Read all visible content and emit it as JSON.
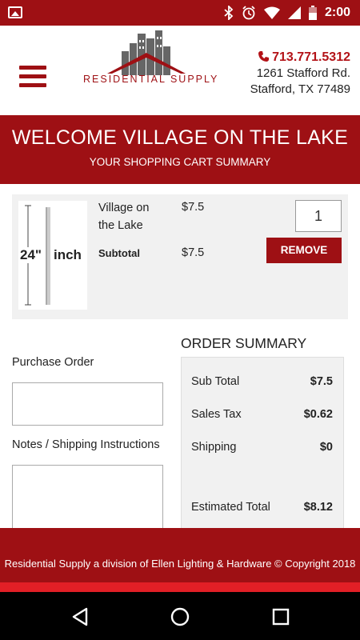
{
  "status_bar": {
    "time": "2:00"
  },
  "header": {
    "logo_text": "RESIDENTIAL SUPPLY",
    "phone": "713.771.5312",
    "address_line1": "1261 Stafford Rd.",
    "address_line2": "Stafford, TX 77489"
  },
  "banner": {
    "title": "WELCOME VILLAGE ON THE LAKE",
    "subtitle": "YOUR SHOPPING CART SUMMARY"
  },
  "cart_item": {
    "image_text_size": "24\"",
    "image_text_unit": "inch",
    "name": "Village on the Lake",
    "price": "$7.5",
    "subtotal_label": "Subtotal",
    "subtotal": "$7.5",
    "quantity": "1",
    "remove_label": "REMOVE"
  },
  "form": {
    "purchase_order_label": "Purchase Order",
    "notes_label": "Notes / Shipping Instructions"
  },
  "order_summary": {
    "title": "ORDER SUMMARY",
    "rows": [
      {
        "label": "Sub Total",
        "value": "$7.5"
      },
      {
        "label": "Sales Tax",
        "value": "$0.62"
      },
      {
        "label": "Shipping",
        "value": "$0"
      },
      {
        "label": "Estimated Total",
        "value": "$8.12"
      }
    ]
  },
  "footer": {
    "text": "Residential Supply a division of Ellen Lighting & Hardware © Copyright 2018"
  },
  "colors": {
    "brand": "#9e1014",
    "accent": "#e21f26"
  }
}
